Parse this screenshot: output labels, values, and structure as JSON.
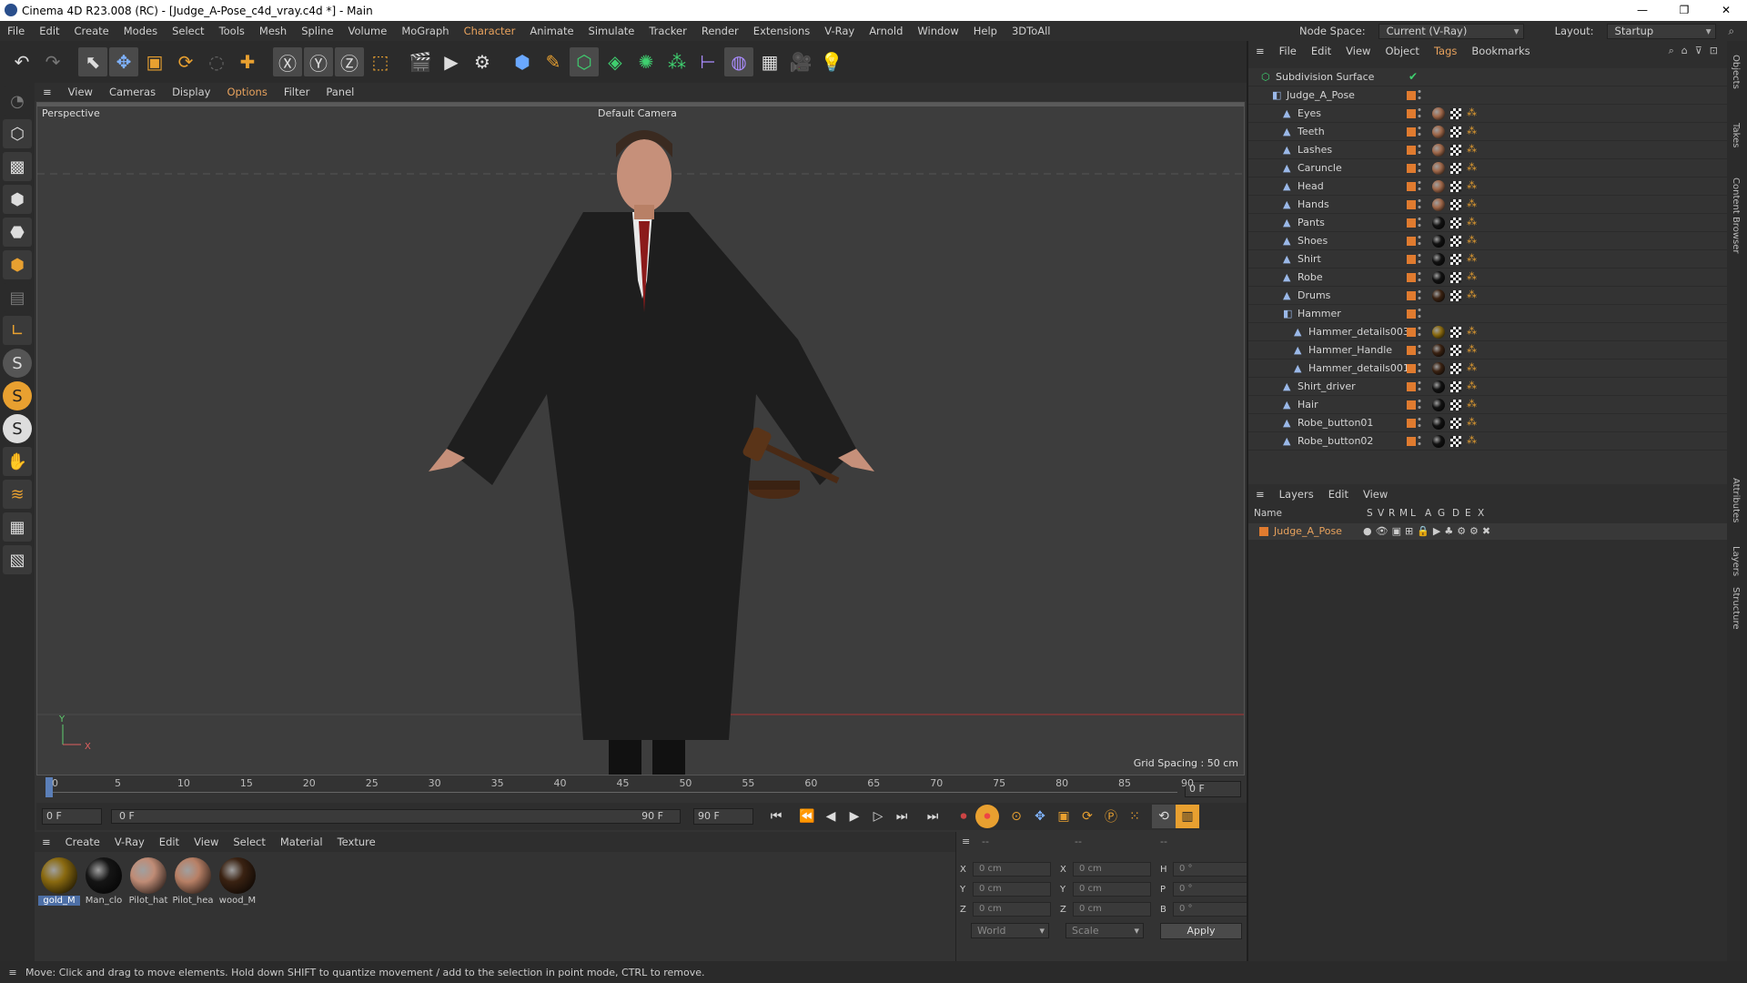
{
  "window": {
    "title": "Cinema 4D R23.008 (RC) - [Judge_A-Pose_c4d_vray.c4d *] - Main",
    "minimize": "—",
    "restore": "❐",
    "close": "✕"
  },
  "menu": [
    "File",
    "Edit",
    "Create",
    "Modes",
    "Select",
    "Tools",
    "Mesh",
    "Spline",
    "Volume",
    "MoGraph",
    "Character",
    "Animate",
    "Simulate",
    "Tracker",
    "Render",
    "Extensions",
    "V-Ray",
    "Arnold",
    "Window",
    "Help",
    "3DToAll"
  ],
  "nodespace": {
    "label": "Node Space:",
    "value": "Current (V-Ray)",
    "layout_label": "Layout:",
    "layout_value": "Startup"
  },
  "viewport_menu": [
    "View",
    "Cameras",
    "Display",
    "Options",
    "Filter",
    "Panel"
  ],
  "viewport": {
    "name": "Perspective",
    "camera": "Default Camera",
    "grid_spacing": "Grid Spacing : 50 cm",
    "axis_y": "Y",
    "axis_x": "X"
  },
  "timeline": {
    "ticks": [
      "0",
      "5",
      "10",
      "15",
      "20",
      "25",
      "30",
      "35",
      "40",
      "45",
      "50",
      "55",
      "60",
      "65",
      "70",
      "75",
      "80",
      "85",
      "90"
    ],
    "end_field": "0 F"
  },
  "playbar": {
    "start": "0 F",
    "current": "0 F",
    "end": "90 F",
    "end2": "90 F"
  },
  "material_menu": [
    "Create",
    "V-Ray",
    "Edit",
    "View",
    "Select",
    "Material",
    "Texture"
  ],
  "materials": [
    {
      "name": "gold_M",
      "color": "#8a6a10"
    },
    {
      "name": "Man_clo",
      "color": "#151515"
    },
    {
      "name": "Pilot_hat",
      "color": "#c08c76"
    },
    {
      "name": "Pilot_hea",
      "color": "#b88066"
    },
    {
      "name": "wood_M",
      "color": "#3a2212"
    }
  ],
  "coords": {
    "x": "X",
    "y": "Y",
    "z": "Z",
    "x2": "X",
    "y2": "Y",
    "z2": "Z",
    "h": "H",
    "p": "P",
    "b": "B",
    "pos_x": "0 cm",
    "pos_y": "0 cm",
    "pos_z": "0 cm",
    "size_x": "0 cm",
    "size_y": "0 cm",
    "size_z": "0 cm",
    "rot_h": "0 °",
    "rot_p": "0 °",
    "rot_b": "0 °",
    "world": "World",
    "scale": "Scale",
    "apply": "Apply",
    "dash1": "--",
    "dash2": "--",
    "dash3": "--"
  },
  "status": "Move: Click and drag to move elements. Hold down SHIFT to quantize movement / add to the selection in point mode, CTRL to remove.",
  "objects_menu": [
    "File",
    "Edit",
    "View",
    "Object",
    "Tags",
    "Bookmarks"
  ],
  "objects": [
    {
      "name": "Subdivision Surface",
      "indent": 0
    },
    {
      "name": "Judge_A_Pose",
      "indent": 1
    },
    {
      "name": "Eyes",
      "indent": 2,
      "mat": "#a0684a"
    },
    {
      "name": "Teeth",
      "indent": 2,
      "mat": "#a0684a"
    },
    {
      "name": "Lashes",
      "indent": 2,
      "mat": "#a0684a"
    },
    {
      "name": "Caruncle",
      "indent": 2,
      "mat": "#a0684a"
    },
    {
      "name": "Head",
      "indent": 2,
      "mat": "#a0684a"
    },
    {
      "name": "Hands",
      "indent": 2,
      "mat": "#a0684a"
    },
    {
      "name": "Pants",
      "indent": 2,
      "mat": "#111111"
    },
    {
      "name": "Shoes",
      "indent": 2,
      "mat": "#111111"
    },
    {
      "name": "Shirt",
      "indent": 2,
      "mat": "#111111"
    },
    {
      "name": "Robe",
      "indent": 2,
      "mat": "#111111"
    },
    {
      "name": "Drums",
      "indent": 2,
      "mat": "#3a2212"
    },
    {
      "name": "Hammer",
      "indent": 2
    },
    {
      "name": "Hammer_details003",
      "indent": 3,
      "mat": "#8a6a10"
    },
    {
      "name": "Hammer_Handle",
      "indent": 3,
      "mat": "#3a2212"
    },
    {
      "name": "Hammer_details001",
      "indent": 3,
      "mat": "#3a2212"
    },
    {
      "name": "Shirt_driver",
      "indent": 2,
      "mat": "#111111"
    },
    {
      "name": "Hair",
      "indent": 2,
      "mat": "#111111"
    },
    {
      "name": "Robe_button01",
      "indent": 2,
      "mat": "#111111"
    },
    {
      "name": "Robe_button02",
      "indent": 2,
      "mat": "#111111"
    }
  ],
  "layers_menu": [
    "Layers",
    "Edit",
    "View"
  ],
  "layers_header": [
    "Name",
    "S",
    "V",
    "R",
    "M",
    "L",
    "A",
    "G",
    "D",
    "E",
    "X"
  ],
  "layer": {
    "name": "Judge_A_Pose",
    "color": "#e07b2f"
  },
  "side_tabs": [
    "Objects",
    "Takes",
    "Content Browser",
    "Attributes",
    "Layers",
    "Structure"
  ]
}
